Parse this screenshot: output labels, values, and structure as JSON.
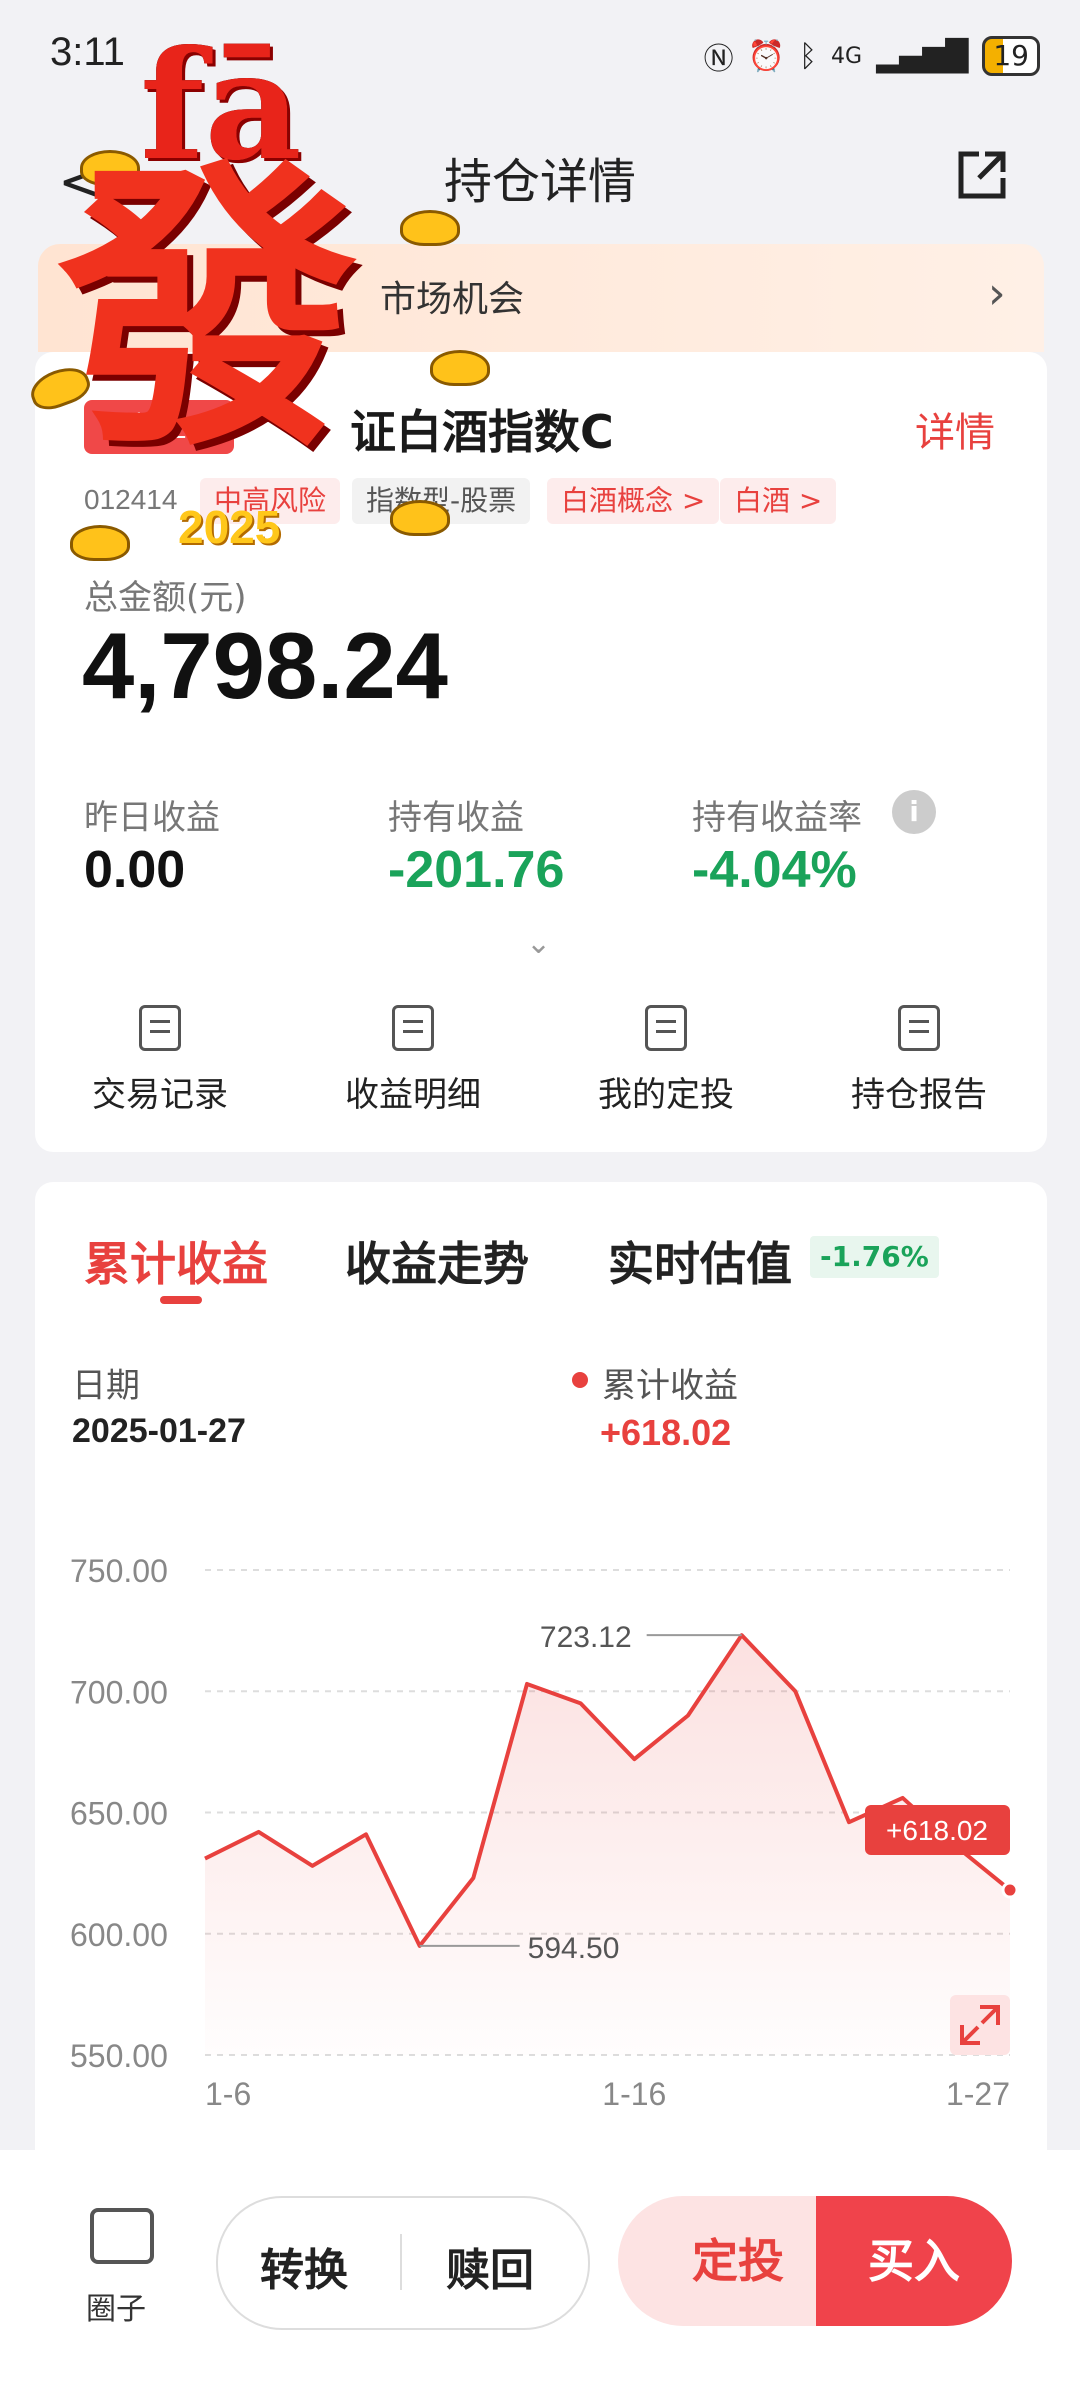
{
  "status_bar": {
    "time": "3:11",
    "network": "4G",
    "battery": "19"
  },
  "header": {
    "title": "持仓详情"
  },
  "banner": {
    "text": "市场机会"
  },
  "fund": {
    "tag": "基金",
    "name": "证白酒指数C",
    "detail_link": "详情",
    "code": "012414",
    "chips": [
      "中高风险",
      "指数型-股票",
      "白酒概念 >",
      "白酒 >"
    ],
    "total_label": "总金额(元)",
    "total_amount": "4,798.24",
    "stats": [
      {
        "label": "昨日收益",
        "value": "0.00",
        "color": "#111111"
      },
      {
        "label": "持有收益",
        "value": "-201.76",
        "color": "#1aa35a"
      },
      {
        "label": "持有收益率",
        "value": "-4.04%",
        "color": "#1aa35a"
      }
    ],
    "info_icon": "i",
    "expand_icon": "⌄"
  },
  "actions": [
    {
      "label": "交易记录",
      "icon": "list-icon"
    },
    {
      "label": "收益明细",
      "icon": "yen-bill-icon"
    },
    {
      "label": "我的定投",
      "icon": "document-icon"
    },
    {
      "label": "持仓报告",
      "icon": "clipboard-check-icon"
    }
  ],
  "chart_section": {
    "tabs": [
      "累计收益",
      "收益走势",
      "实时估值"
    ],
    "estimate_badge": "-1.76%",
    "date_label": "日期",
    "date_value": "2025-01-27",
    "legend_label": "累计收益",
    "legend_value": "+618.02"
  },
  "chart_data": {
    "type": "area",
    "series": [
      {
        "name": "累计收益",
        "values": [
          631,
          642,
          628,
          641,
          595,
          623,
          703,
          695,
          672,
          690,
          723.12,
          700,
          646,
          656,
          636,
          618.02
        ]
      }
    ],
    "x_ticks": [
      "1-6",
      "1-16",
      "1-27"
    ],
    "y_ticks": [
      "750.00",
      "700.00",
      "650.00",
      "600.00",
      "550.00"
    ],
    "ylim": [
      550,
      750
    ],
    "annotations": {
      "max": "723.12",
      "min": "594.50",
      "last": "+618.02"
    },
    "grid": true,
    "color": "#e8413e"
  },
  "bottom_bar": {
    "circle_label": "圈子",
    "convert": "转换",
    "redeem": "赎回",
    "auto_invest": "定投",
    "buy": "买入"
  },
  "sticker": {
    "pinyin": "fā",
    "character": "發",
    "year": "2025"
  }
}
